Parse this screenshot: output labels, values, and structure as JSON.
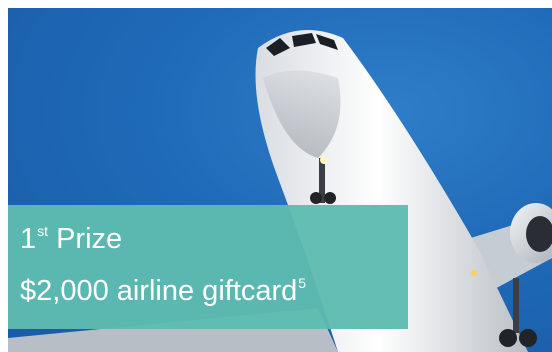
{
  "promo": {
    "place_number": "1",
    "place_suffix": "st",
    "place_word": "Prize",
    "prize_text": "$2,000 airline giftcard",
    "footnote_ref": "5"
  },
  "image": {
    "subject": "airplane-photo"
  },
  "colors": {
    "sky": "#1f6ab8",
    "overlay": "#5ebbb0",
    "text": "#ffffff"
  }
}
